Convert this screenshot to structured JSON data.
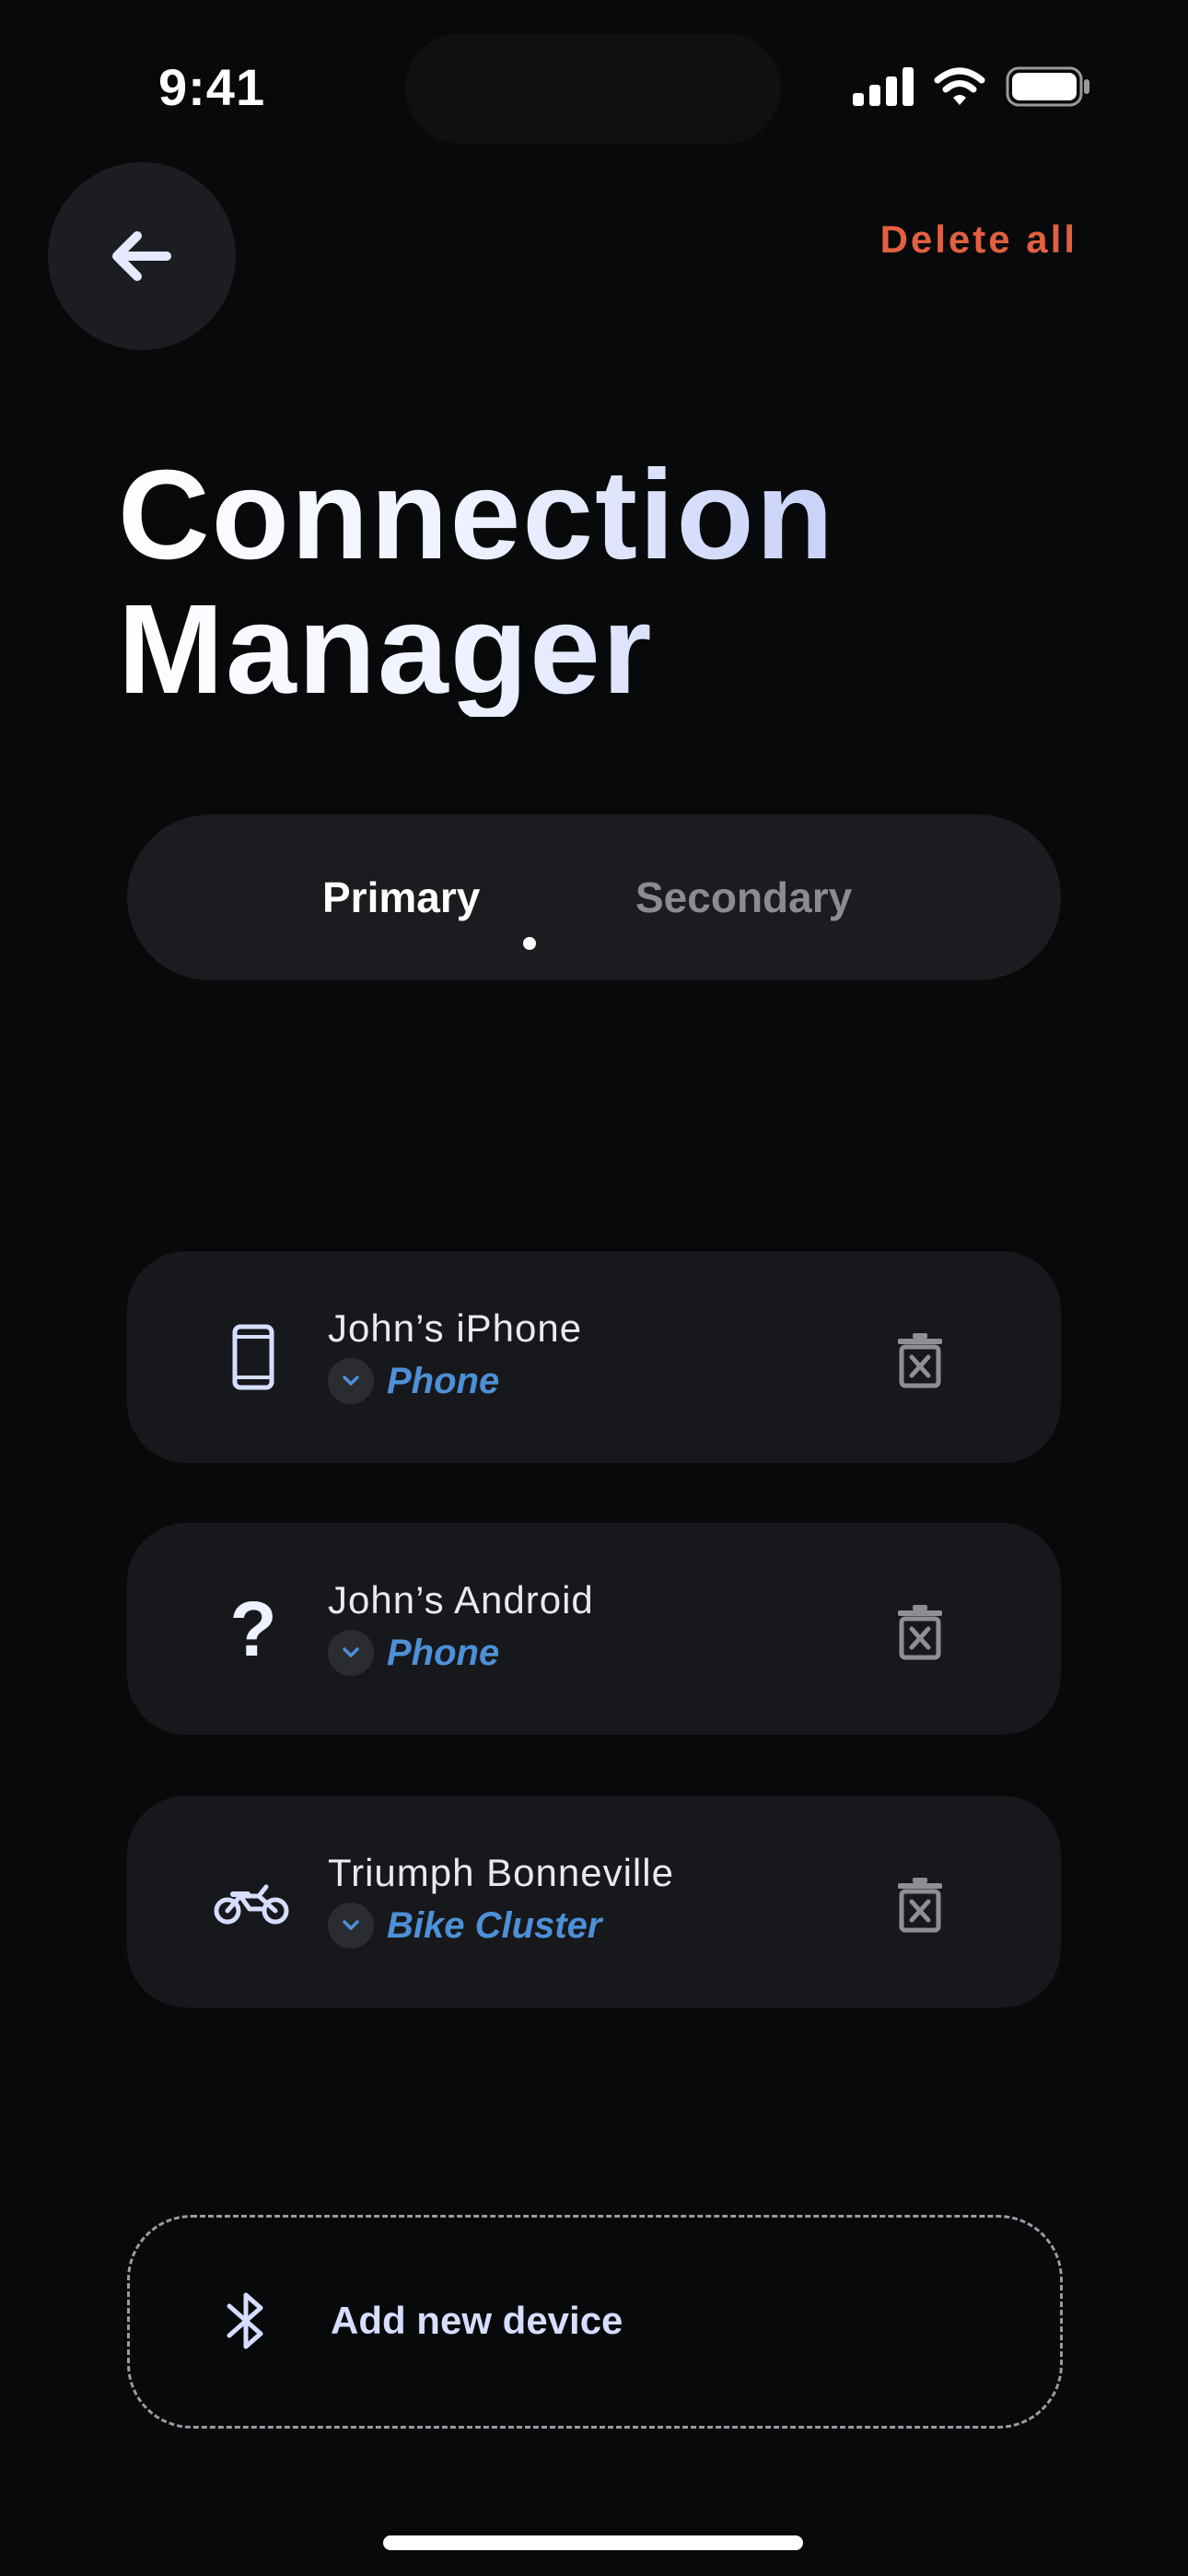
{
  "status_bar": {
    "time": "9:41",
    "icons": [
      "signal-icon",
      "wifi-icon",
      "battery-icon"
    ]
  },
  "header": {
    "back_icon": "arrow-left-icon",
    "delete_all_label": "Delete all",
    "title_line1": "Connection",
    "title_line2": "Manager"
  },
  "tabs": {
    "primary_label": "Primary",
    "secondary_label": "Secondary",
    "active": "Primary"
  },
  "devices": [
    {
      "name": "John’s iPhone",
      "type": "Phone",
      "icon": "smartphone-icon"
    },
    {
      "name": "John’s Android",
      "type": "Phone",
      "icon": "question-icon",
      "icon_glyph": "?"
    },
    {
      "name": "Triumph Bonneville",
      "type": "Bike Cluster",
      "icon": "motorcycle-icon"
    }
  ],
  "add_device": {
    "label": "Add new device",
    "icon": "bluetooth-icon"
  },
  "colors": {
    "background": "#07090b",
    "card": "#17181b",
    "accent_blue": "#4d90d8",
    "delete_orange": "#e2603f",
    "muted_text": "#8a8c90"
  }
}
